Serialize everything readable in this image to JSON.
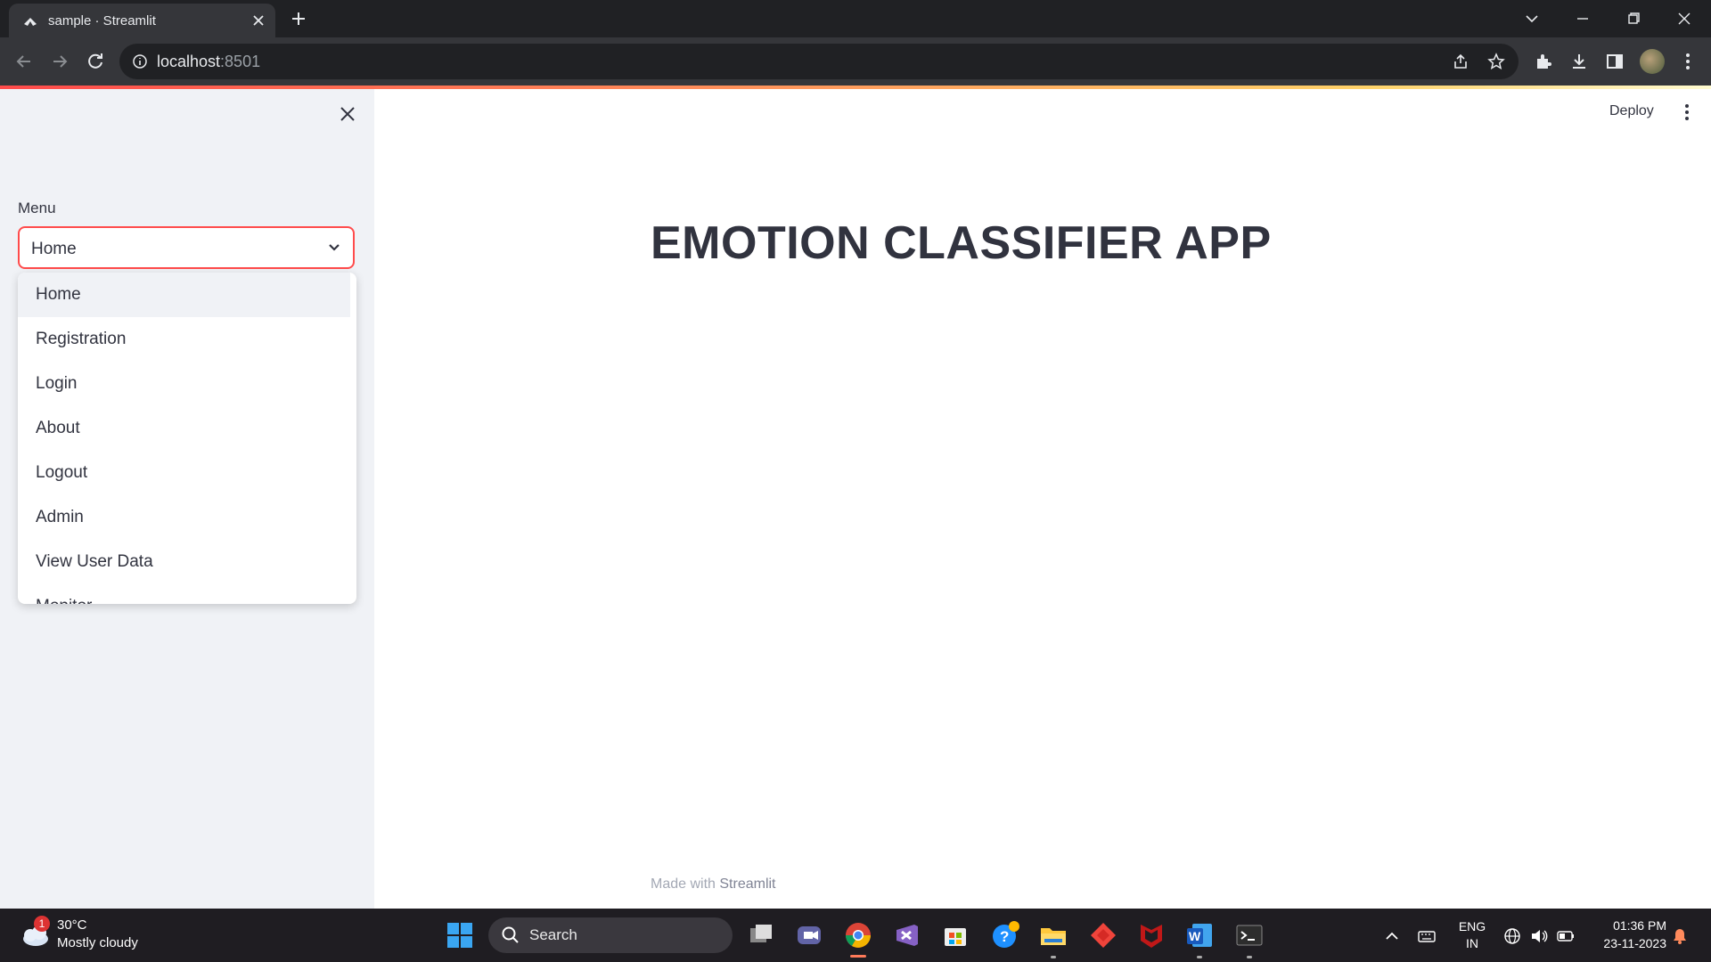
{
  "browser": {
    "tab_title": "sample · Streamlit",
    "url_host": "localhost",
    "url_port": ":8501"
  },
  "sidebar": {
    "menu_label": "Menu",
    "selected": "Home",
    "options": [
      "Home",
      "Registration",
      "Login",
      "About",
      "Logout",
      "Admin",
      "View User Data",
      "Monitor"
    ]
  },
  "main": {
    "deploy_label": "Deploy",
    "title": "EMOTION CLASSIFIER APP",
    "footer_prefix": "Made with",
    "footer_brand": "Streamlit"
  },
  "taskbar": {
    "weather_badge": "1",
    "weather_temp": "30°C",
    "weather_desc": "Mostly cloudy",
    "search_label": "Search",
    "lang_line1": "ENG",
    "lang_line2": "IN",
    "time": "01:36 PM",
    "date": "23-11-2023"
  },
  "colors": {
    "accent": "#ff4b4b",
    "sidebar_bg": "#f0f2f6",
    "text": "#31333f"
  }
}
